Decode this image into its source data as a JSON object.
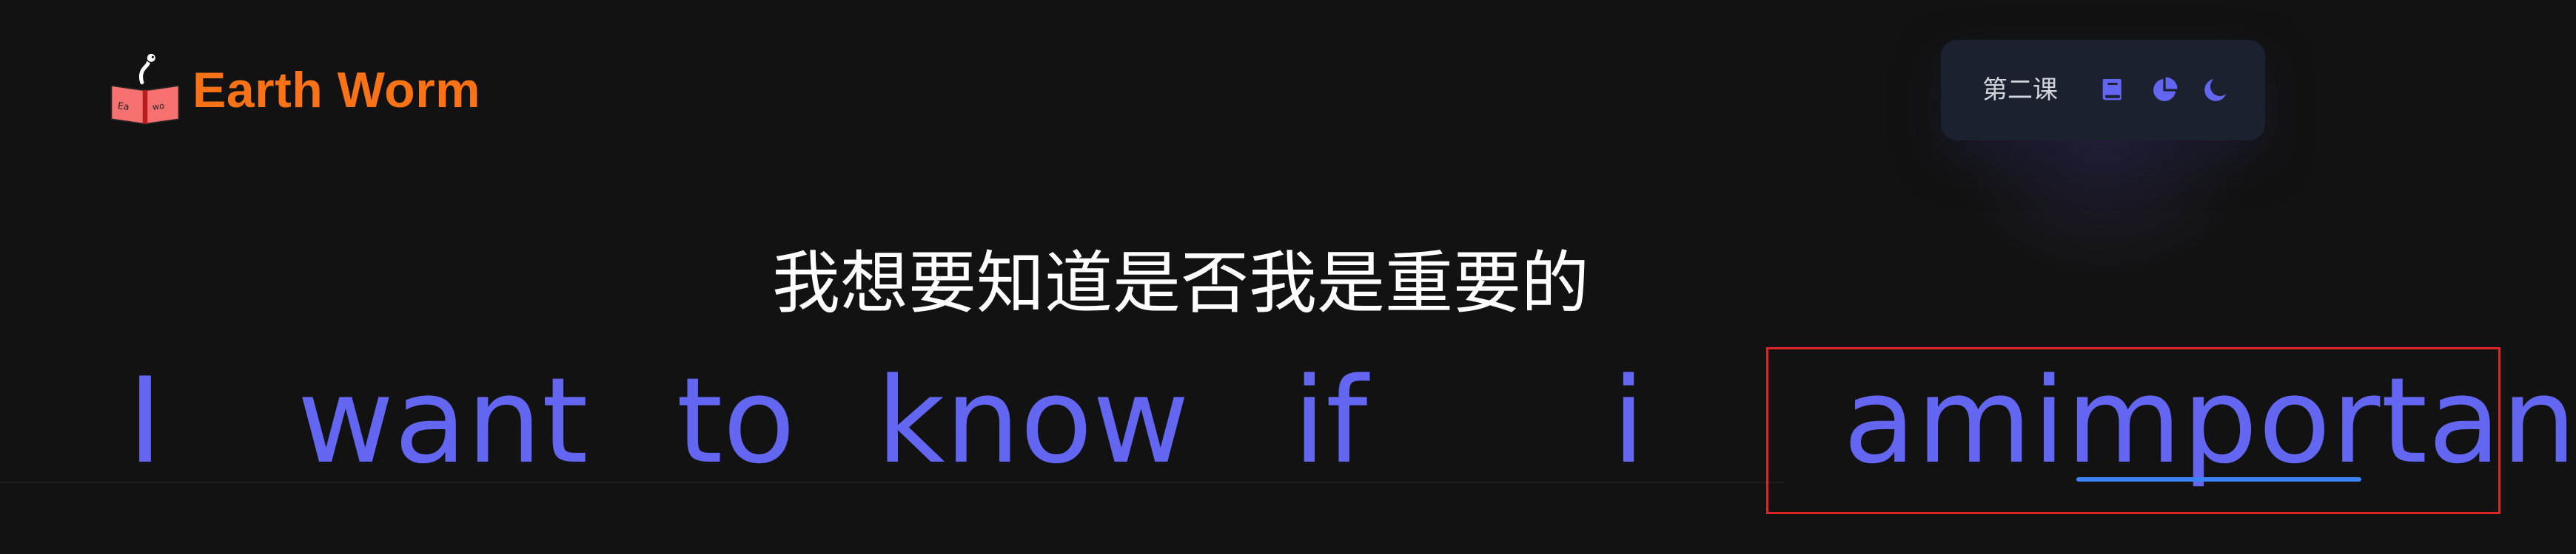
{
  "header": {
    "logo_text": "Earth Worm",
    "logo_icon": "earth-worm-book-logo"
  },
  "toolbar": {
    "lesson_label": "第二课",
    "icons": [
      "book-icon",
      "pie-chart-icon",
      "moon-icon"
    ]
  },
  "sentence": {
    "translation": "我想要知道是否我是重要的",
    "words": [
      {
        "text": "I"
      },
      {
        "text": "want"
      },
      {
        "text": "to"
      },
      {
        "text": "know"
      },
      {
        "text": "if"
      },
      {
        "text": "i"
      },
      {
        "text": "amimportant"
      }
    ]
  },
  "colors": {
    "background": "#121212",
    "brand": "#f97316",
    "word": "#6366f1",
    "cursor": "#3b82f6",
    "focus_box": "#dc2626"
  }
}
